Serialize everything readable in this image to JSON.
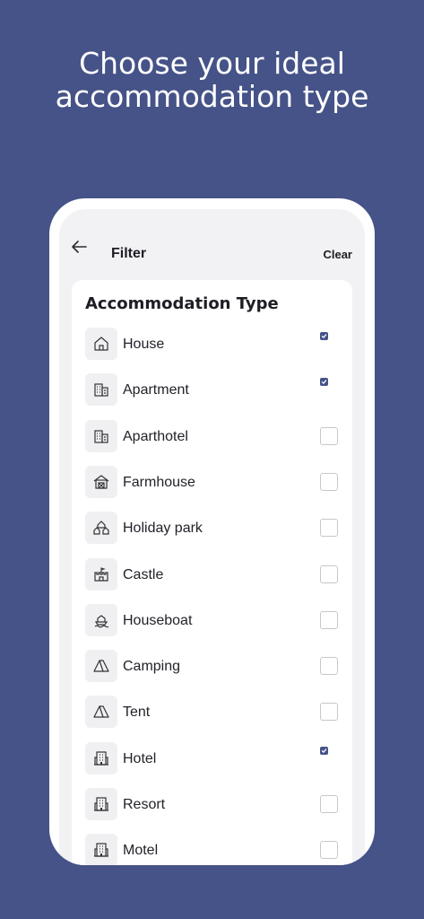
{
  "headline": {
    "line1": "Choose your ideal",
    "line2": "accommodation type"
  },
  "appbar": {
    "title": "Filter",
    "clear_label": "Clear",
    "back_icon": "arrow-left-icon"
  },
  "section": {
    "title": "Accommodation Type"
  },
  "accent_color": "#465388",
  "options": [
    {
      "label": "House",
      "icon": "house-icon",
      "checked": true
    },
    {
      "label": "Apartment",
      "icon": "building-icon",
      "checked": true
    },
    {
      "label": "Aparthotel",
      "icon": "building-icon",
      "checked": false
    },
    {
      "label": "Farmhouse",
      "icon": "farmhouse-icon",
      "checked": false
    },
    {
      "label": "Holiday park",
      "icon": "holiday-park-icon",
      "checked": false
    },
    {
      "label": "Castle",
      "icon": "castle-icon",
      "checked": false
    },
    {
      "label": "Houseboat",
      "icon": "houseboat-icon",
      "checked": false
    },
    {
      "label": "Camping",
      "icon": "tent-icon",
      "checked": false
    },
    {
      "label": "Tent",
      "icon": "tent-icon",
      "checked": false
    },
    {
      "label": "Hotel",
      "icon": "hotel-icon",
      "checked": true
    },
    {
      "label": "Resort",
      "icon": "hotel-icon",
      "checked": false
    },
    {
      "label": "Motel",
      "icon": "hotel-icon",
      "checked": false
    }
  ]
}
